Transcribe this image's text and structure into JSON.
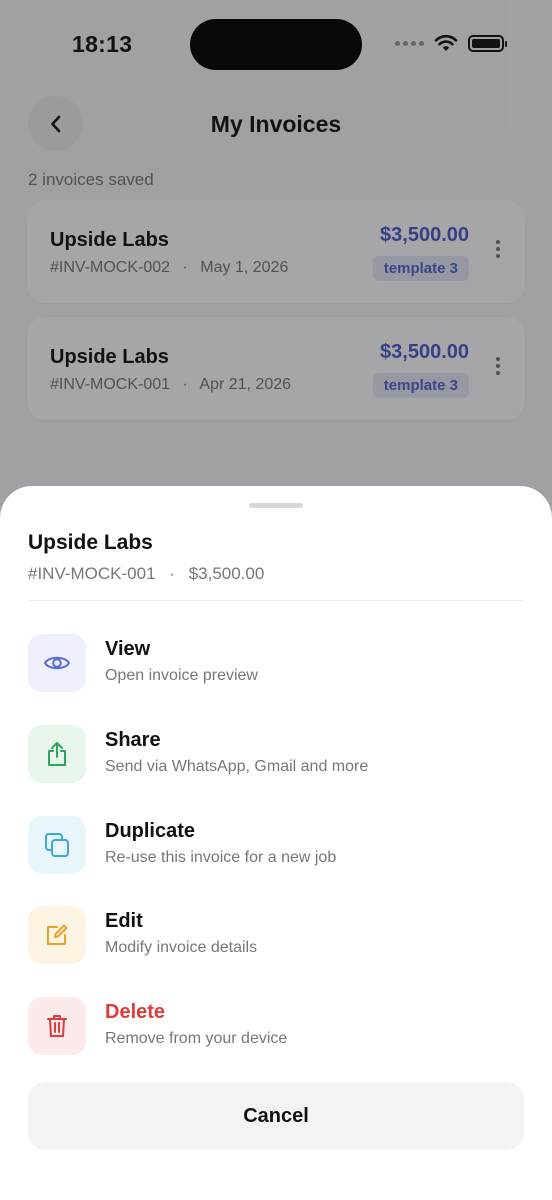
{
  "status": {
    "time": "18:13"
  },
  "header": {
    "title": "My Invoices",
    "count": "2 invoices saved"
  },
  "invoices": [
    {
      "client": "Upside Labs",
      "number": "#INV-MOCK-002",
      "date": "May 1, 2026",
      "amount": "$3,500.00",
      "template": "template 3"
    },
    {
      "client": "Upside Labs",
      "number": "#INV-MOCK-001",
      "date": "Apr 21, 2026",
      "amount": "$3,500.00",
      "template": "template 3"
    }
  ],
  "separator": "·",
  "sheet": {
    "title": "Upside Labs",
    "number": "#INV-MOCK-001",
    "amount": "$3,500.00",
    "actions": [
      {
        "label": "View",
        "desc": "Open invoice preview",
        "icon": "eye-icon",
        "color": "#5b6bd0",
        "bg": "#eef0fc"
      },
      {
        "label": "Share",
        "desc": "Send via WhatsApp, Gmail and more",
        "icon": "share-icon",
        "color": "#2fa45a",
        "bg": "#e8f6ec"
      },
      {
        "label": "Duplicate",
        "desc": "Re-use this invoice for a new job",
        "icon": "duplicate-icon",
        "color": "#3aa9d9",
        "bg": "#e8f5fb"
      },
      {
        "label": "Edit",
        "desc": "Modify invoice details",
        "icon": "edit-icon",
        "color": "#e9a326",
        "bg": "#fdf4e4"
      },
      {
        "label": "Delete",
        "desc": "Remove from your device",
        "icon": "trash-icon",
        "color": "#e03b3b",
        "bg": "#fdeaea"
      }
    ],
    "cancel": "Cancel"
  }
}
